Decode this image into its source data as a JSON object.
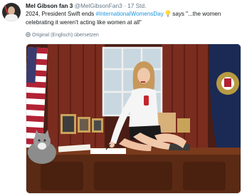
{
  "tweet": {
    "author_name": "Mel Gibson fan 3",
    "handle": "@MelGibsonFan3",
    "separator": "·",
    "time": "17 Std.",
    "text_prefix": "2024, President Swift ends ",
    "hashtag": "#InternationalWomensDay",
    "text_suffix_line1": " says \"...the women",
    "text_line2": "celebrating it weren't acting like women at all\"",
    "translate_label": "Original (Englisch) übersetzen",
    "image_alt": "Woman in white shirt sitting cross-legged on the desk in the Oval Office holding a soda can, next to a grey cat"
  },
  "icons": {
    "bulb": "lightbulb-emoji",
    "globe": "globe-icon"
  },
  "colors": {
    "link": "#1b95e0",
    "meta": "#657786",
    "text": "#14171a"
  }
}
